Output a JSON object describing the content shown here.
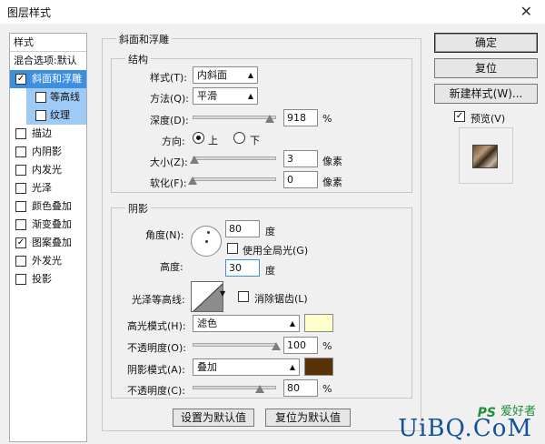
{
  "window": {
    "title": "图层样式",
    "close": "✕"
  },
  "stylelist": {
    "header": "样式",
    "blend_default": "混合选项:默认",
    "items": [
      {
        "label": "斜面和浮雕",
        "checked": "✓"
      },
      {
        "label": "等高线",
        "checked": ""
      },
      {
        "label": "纹理",
        "checked": ""
      },
      {
        "label": "描边",
        "checked": ""
      },
      {
        "label": "内阴影",
        "checked": ""
      },
      {
        "label": "内发光",
        "checked": ""
      },
      {
        "label": "光泽",
        "checked": ""
      },
      {
        "label": "颜色叠加",
        "checked": ""
      },
      {
        "label": "渐变叠加",
        "checked": ""
      },
      {
        "label": "图案叠加",
        "checked": "✓"
      },
      {
        "label": "外发光",
        "checked": ""
      },
      {
        "label": "投影",
        "checked": ""
      }
    ]
  },
  "bevel": {
    "group_title": "斜面和浮雕",
    "structure": {
      "title": "结构",
      "style_label": "样式(T):",
      "style_value": "内斜面",
      "technique_label": "方法(Q):",
      "technique_value": "平滑",
      "depth_label": "深度(D):",
      "depth_value": "918",
      "depth_unit": "%",
      "depth_slider": 0.92,
      "direction_label": "方向:",
      "dir_up": "上",
      "dir_down": "下",
      "size_label": "大小(Z):",
      "size_value": "3",
      "size_unit": "像素",
      "size_slider": 0.02,
      "soften_label": "软化(F):",
      "soften_value": "0",
      "soften_unit": "像素",
      "soften_slider": 0.0
    },
    "shading": {
      "title": "阴影",
      "angle_label": "角度(N):",
      "angle_value": "80",
      "angle_unit": "度",
      "global_light_label": "使用全局光(G)",
      "altitude_label": "高度:",
      "altitude_value": "30",
      "altitude_unit": "度",
      "gloss_label": "光泽等高线:",
      "antialias_label": "消除锯齿(L)",
      "highlight_mode_label": "高光模式(H):",
      "highlight_mode_value": "滤色",
      "highlight_color": "#ffffcc",
      "highlight_opacity_label": "不透明度(O):",
      "highlight_opacity_value": "100",
      "highlight_opacity_slider": 1.0,
      "shadow_mode_label": "阴影模式(A):",
      "shadow_mode_value": "叠加",
      "shadow_color": "#5a3208",
      "shadow_opacity_label": "不透明度(C):",
      "shadow_opacity_value": "80",
      "shadow_opacity_slider": 0.8,
      "pct": "%"
    },
    "make_default": "设置为默认值",
    "reset_default": "复位为默认值"
  },
  "actions": {
    "ok": "确定",
    "reset": "复位",
    "new_style": "新建样式(W)...",
    "preview_label": "预览(V)",
    "preview_checked": "✓"
  },
  "watermark": {
    "ps": "PS",
    "cn": "爱好者",
    "main": "UiBQ.CoM"
  }
}
